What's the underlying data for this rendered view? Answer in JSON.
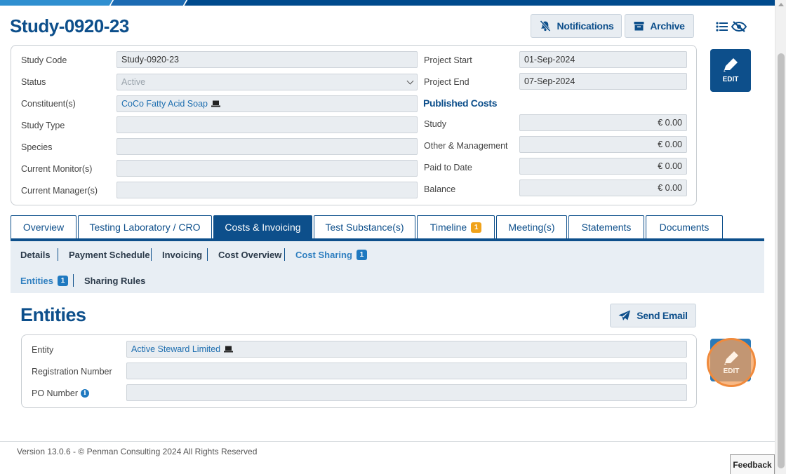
{
  "header": {
    "title": "Study-0920-23",
    "notifications_label": "Notifications",
    "archive_label": "Archive"
  },
  "study": {
    "study_code_label": "Study Code",
    "study_code_value": "Study-0920-23",
    "status_label": "Status",
    "status_value": "Active",
    "constituents_label": "Constituent(s)",
    "constituents_value": "CoCo Fatty Acid Soap",
    "study_type_label": "Study Type",
    "study_type_value": "",
    "species_label": "Species",
    "species_value": "",
    "monitors_label": "Current Monitor(s)",
    "monitors_value": "",
    "managers_label": "Current Manager(s)",
    "managers_value": "",
    "project_start_label": "Project Start",
    "project_start_value": "01-Sep-2024",
    "project_end_label": "Project End",
    "project_end_value": "07-Sep-2024"
  },
  "published_costs": {
    "title": "Published Costs",
    "study_label": "Study",
    "study_value": "€ 0.00",
    "other_label": "Other & Management",
    "other_value": "€ 0.00",
    "paid_label": "Paid to Date",
    "paid_value": "€ 0.00",
    "balance_label": "Balance",
    "balance_value": "€ 0.00"
  },
  "edit_label": "EDIT",
  "tabs": [
    {
      "label": "Overview"
    },
    {
      "label": "Testing Laboratory / CRO"
    },
    {
      "label": "Costs & Invoicing"
    },
    {
      "label": "Test Substance(s)"
    },
    {
      "label": "Timeline",
      "badge": "1"
    },
    {
      "label": "Meeting(s)"
    },
    {
      "label": "Statements"
    },
    {
      "label": "Documents"
    }
  ],
  "subnav": {
    "details": "Details",
    "payment_schedule": "Payment Schedule",
    "invoicing": "Invoicing",
    "cost_overview": "Cost Overview",
    "cost_sharing": "Cost Sharing",
    "cost_sharing_badge": "1",
    "entities": "Entities",
    "entities_badge": "1",
    "sharing_rules": "Sharing Rules"
  },
  "entities": {
    "title": "Entities",
    "send_email_label": "Send Email",
    "entity_label": "Entity",
    "entity_value": "Active Steward Limited",
    "registration_label": "Registration Number",
    "registration_value": "",
    "po_label": "PO Number",
    "po_value": ""
  },
  "footer": {
    "version": "Version 13.0.6 - © Penman Consulting 2024 All Rights Reserved",
    "feedback": "Feedback"
  },
  "colors": {
    "primary": "#0d4f8b",
    "accent": "#2f7fc0",
    "badge_orange": "#f0a21a",
    "focus_orange": "#f08a3c"
  }
}
